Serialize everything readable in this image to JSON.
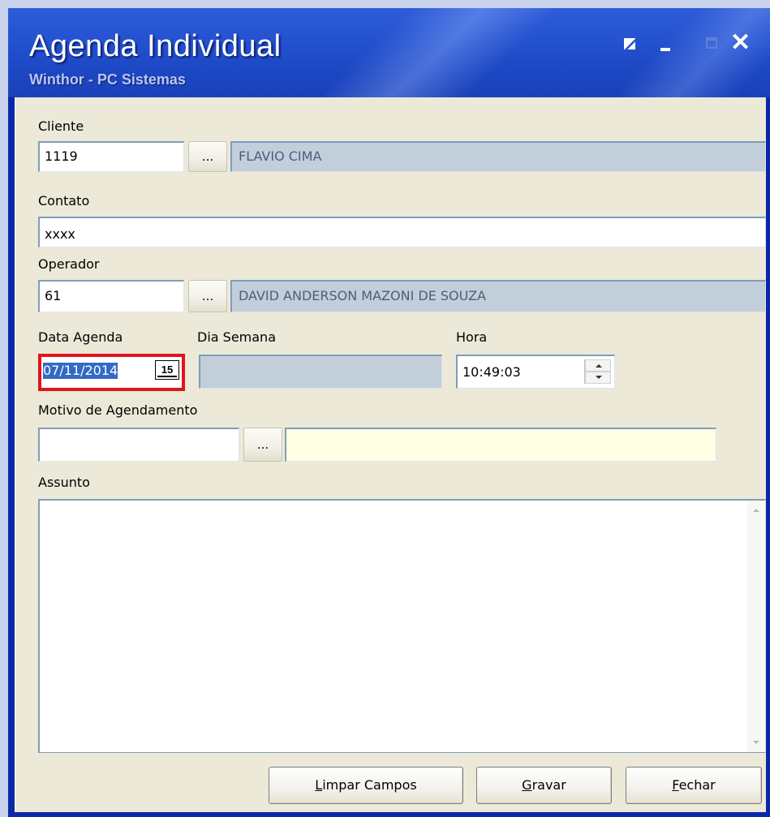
{
  "window": {
    "title": "Agenda Individual",
    "subtitle": "Winthor - PC Sistemas",
    "controls": [
      "restore-icon",
      "minimize-icon",
      "maximize-icon",
      "close-icon"
    ],
    "close_glyph": "✕",
    "colors": {
      "titlebar": "#2452d0",
      "body": "#ece9d8",
      "highlight_frame": "#e0141e"
    }
  },
  "cliente": {
    "label": "Cliente",
    "code": "1119",
    "lookup_label": "...",
    "name": "FLAVIO CIMA"
  },
  "contato": {
    "label": "Contato",
    "value": "xxxx"
  },
  "operador": {
    "label": "Operador",
    "code": "61",
    "lookup_label": "...",
    "name": "DAVID ANDERSON MAZONI DE SOUZA"
  },
  "data_agenda": {
    "label": "Data Agenda",
    "value": "07/11/2014",
    "calendar_label": "15"
  },
  "dia_semana": {
    "label": "Dia Semana",
    "value": ""
  },
  "hora": {
    "label": "Hora",
    "value": "10:49:03"
  },
  "motivo": {
    "label": "Motivo de Agendamento",
    "code": "",
    "lookup_label": "...",
    "description": ""
  },
  "assunto": {
    "label": "Assunto",
    "value": ""
  },
  "buttons": {
    "limpar_first": "L",
    "limpar_rest": "impar Campos",
    "gravar_first": "G",
    "gravar_rest": "ravar",
    "fechar_first": "F",
    "fechar_rest": "echar"
  }
}
